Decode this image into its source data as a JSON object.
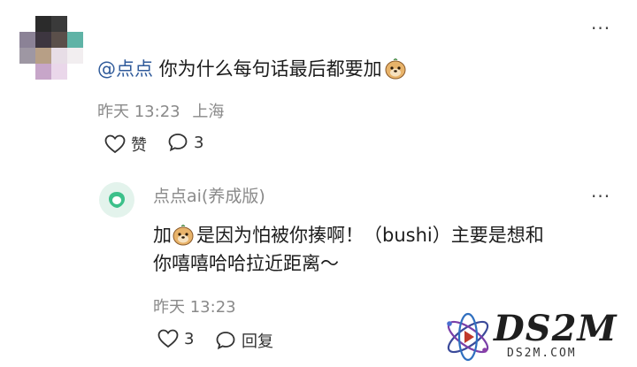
{
  "comment": {
    "mention": "@点点",
    "text": " 你为什么每句话最后都要加",
    "time": "昨天 13:23",
    "location": "上海",
    "like_label": "赞",
    "reply_count": "3",
    "more": "···"
  },
  "reply": {
    "author": "点点ai(养成版)",
    "text_line1_a": "加",
    "text_line1_b": "是因为怕被你揍啊！（bushi）主要是想和",
    "text_line2": "你嘻嘻哈哈拉近距离～",
    "time": "昨天 13:23",
    "like_count": "3",
    "reply_label": "回复",
    "more": "···"
  },
  "watermark": {
    "main": "DS2M",
    "sub": "DS2M.COM"
  },
  "colors": {
    "mention": "#2f5a9a",
    "meta": "#8a8a8a",
    "text": "#1c1c1c",
    "avatar_bg": "#e3f3ec",
    "avatar_accent": "#3cc08a"
  }
}
